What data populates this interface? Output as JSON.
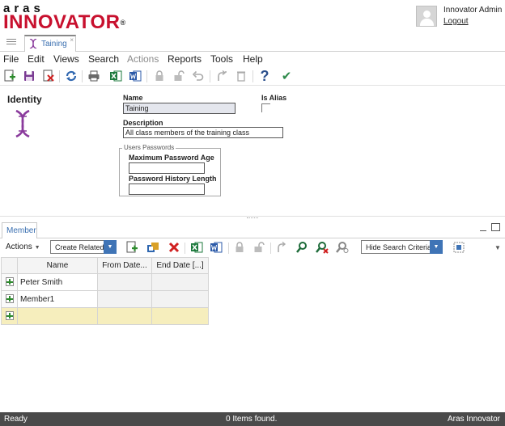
{
  "header": {
    "logo_top": "aras",
    "logo_main": "INNOVATOR",
    "logo_reg": "®",
    "user_name": "Innovator Admin",
    "logout_label": "Logout"
  },
  "doc_tab": {
    "label": "Taining",
    "close": "×"
  },
  "menu": {
    "items": [
      {
        "label": "File",
        "enabled": true
      },
      {
        "label": "Edit",
        "enabled": true
      },
      {
        "label": "Views",
        "enabled": true
      },
      {
        "label": "Search",
        "enabled": true
      },
      {
        "label": "Actions",
        "enabled": false
      },
      {
        "label": "Reports",
        "enabled": true
      },
      {
        "label": "Tools",
        "enabled": true
      },
      {
        "label": "Help",
        "enabled": true
      }
    ]
  },
  "toolbar": {
    "icons": [
      "new-item-icon",
      "save-icon",
      "delete-icon",
      "refresh-icon",
      "print-icon",
      "excel-icon",
      "word-icon",
      "lock-icon",
      "unlock-icon",
      "undo-icon",
      "promote-icon",
      "purge-icon",
      "help-icon",
      "done-icon"
    ],
    "help_glyph": "?",
    "done_glyph": "✔"
  },
  "form": {
    "title": "Identity",
    "name_label": "Name",
    "name_value": "Taining",
    "is_alias_label": "Is Alias",
    "is_alias_checked": false,
    "description_label": "Description",
    "description_value": "All class members of the training class",
    "users_passwords_legend": "Users Passwords",
    "max_password_age_label": "Maximum Password Age",
    "max_password_age_value": "",
    "password_history_label": "Password History Length",
    "password_history_value": ""
  },
  "relationships": {
    "tab_label": "Member",
    "actions_label": "Actions",
    "create_related_label": "Create Related",
    "hide_search_label": "Hide Search Criteria",
    "columns": [
      "Name",
      "From Date...",
      "End Date [...]"
    ],
    "rows": [
      {
        "name": "Peter Smith",
        "from_date": "",
        "end_date": ""
      },
      {
        "name": "Member1",
        "from_date": "",
        "end_date": ""
      },
      {
        "name": "",
        "from_date": "",
        "end_date": ""
      }
    ]
  },
  "status": {
    "left": "Ready",
    "middle": "0 Items found.",
    "right": "Aras Innovator"
  },
  "colors": {
    "brand_red": "#c8102e",
    "accent_blue": "#3f74b6",
    "status_bar": "#4a4a4a",
    "new_row": "#f6eebd"
  }
}
